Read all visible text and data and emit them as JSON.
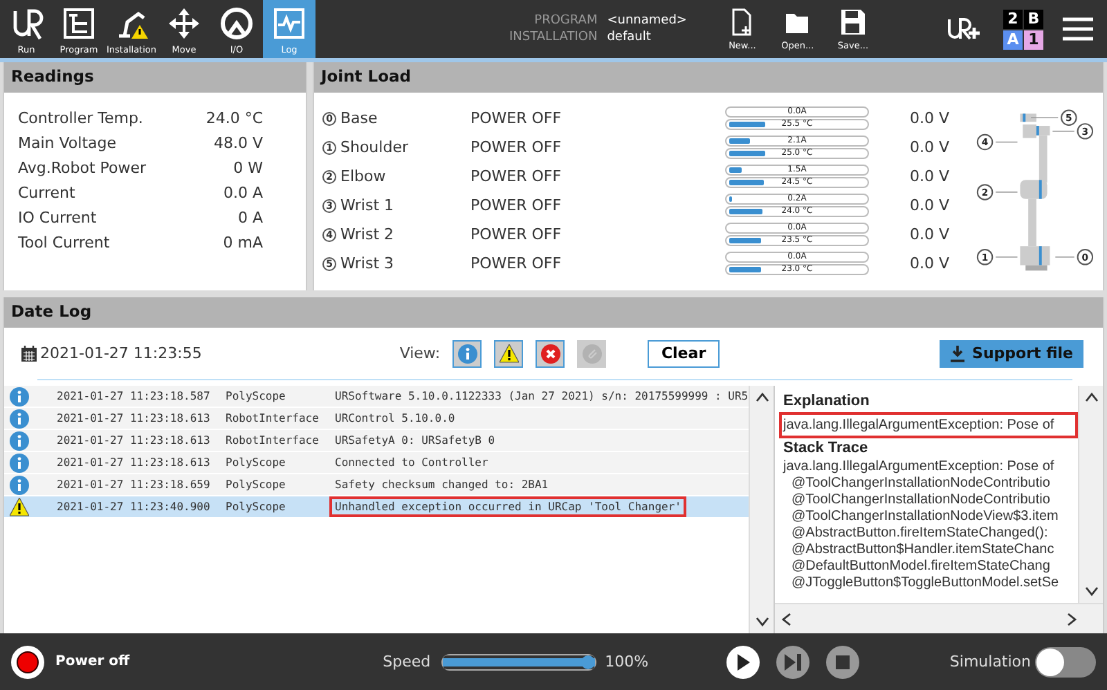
{
  "nav": [
    {
      "kind": "run",
      "label": "Run",
      "selected": false
    },
    {
      "kind": "program",
      "label": "Program",
      "selected": false
    },
    {
      "kind": "installation",
      "label": "Installation",
      "selected": false
    },
    {
      "kind": "move",
      "label": "Move",
      "selected": false
    },
    {
      "kind": "io",
      "label": "I/O",
      "selected": false
    },
    {
      "kind": "log",
      "label": "Log",
      "selected": true
    }
  ],
  "program_info": [
    {
      "label": "PROGRAM",
      "value": "<unnamed>"
    },
    {
      "label": "INSTALLATION",
      "value": "default"
    }
  ],
  "file_buttons": [
    {
      "kind": "new",
      "label": "New..."
    },
    {
      "kind": "open",
      "label": "Open..."
    },
    {
      "kind": "save",
      "label": "Save..."
    }
  ],
  "safety_status": [
    {
      "text": "2",
      "color": "#000000"
    },
    {
      "text": "B",
      "color": "#000000"
    },
    {
      "text": "A",
      "color": "#5b8ff0"
    },
    {
      "text": "1",
      "color": "#e6a8e6"
    }
  ],
  "readings": {
    "title": "Readings",
    "rows": [
      {
        "label": "Controller Temp.",
        "value": "24.0 °C"
      },
      {
        "label": "Main Voltage",
        "value": "48.0 V"
      },
      {
        "label": "Avg.Robot Power",
        "value": "0 W"
      },
      {
        "label": "Current",
        "value": "0.0 A"
      },
      {
        "label": "IO Current",
        "value": "0 A"
      },
      {
        "label": "Tool Current",
        "value": "0 mA"
      }
    ]
  },
  "joint_load": {
    "title": "Joint Load",
    "joints": [
      {
        "index": "0",
        "name": "Base",
        "status": "POWER OFF",
        "current": {
          "text": "0.0A",
          "level": 0
        },
        "temperature": {
          "text": "25.5 °C",
          "level": 0.25
        },
        "voltage": "0.0 V"
      },
      {
        "index": "1",
        "name": "Shoulder",
        "status": "POWER OFF",
        "current": {
          "text": "2.1A",
          "level": 0.15
        },
        "temperature": {
          "text": "25.0 °C",
          "level": 0.25
        },
        "voltage": "0.0 V"
      },
      {
        "index": "2",
        "name": "Elbow",
        "status": "POWER OFF",
        "current": {
          "text": "1.5A",
          "level": 0.09
        },
        "temperature": {
          "text": "24.5 °C",
          "level": 0.245
        },
        "voltage": "0.0 V"
      },
      {
        "index": "3",
        "name": "Wrist 1",
        "status": "POWER OFF",
        "current": {
          "text": "0.2A",
          "level": 0.02
        },
        "temperature": {
          "text": "24.0 °C",
          "level": 0.24
        },
        "voltage": "0.0 V"
      },
      {
        "index": "4",
        "name": "Wrist 2",
        "status": "POWER OFF",
        "current": {
          "text": "0.0A",
          "level": 0
        },
        "temperature": {
          "text": "23.5 °C",
          "level": 0.23
        },
        "voltage": "0.0 V"
      },
      {
        "index": "5",
        "name": "Wrist 3",
        "status": "POWER OFF",
        "current": {
          "text": "0.0A",
          "level": 0
        },
        "temperature": {
          "text": "23.0 °C",
          "level": 0.23
        },
        "voltage": "0.0 V"
      }
    ],
    "robot_callouts": [
      "5",
      "3",
      "4",
      "2",
      "1",
      "0"
    ]
  },
  "date_log": {
    "title": "Date Log",
    "date": "2021-01-27 11:23:55",
    "view_label": "View:",
    "filters": [
      {
        "kind": "info",
        "on": true
      },
      {
        "kind": "warning",
        "on": true
      },
      {
        "kind": "error",
        "on": true
      },
      {
        "kind": "attachment",
        "on": false
      }
    ],
    "clear_button": "Clear",
    "support_button": "Support file",
    "entries": [
      {
        "kind": "info",
        "time": "2021-01-27 11:23:18.587",
        "source": "PolyScope",
        "message": "URSoftware 5.10.0.1122333 (Jan 27 2021) s/n: 20175599999 : UR5",
        "selected": false,
        "highlighted": false
      },
      {
        "kind": "info",
        "time": "2021-01-27 11:23:18.613",
        "source": "RobotInterface",
        "message": "URControl 5.10.0.0",
        "selected": false,
        "highlighted": false
      },
      {
        "kind": "info",
        "time": "2021-01-27 11:23:18.613",
        "source": "RobotInterface",
        "message": "URSafetyA 0: URSafetyB 0",
        "selected": false,
        "highlighted": false
      },
      {
        "kind": "info",
        "time": "2021-01-27 11:23:18.613",
        "source": "PolyScope",
        "message": "Connected to Controller",
        "selected": false,
        "highlighted": false
      },
      {
        "kind": "info",
        "time": "2021-01-27 11:23:18.659",
        "source": "PolyScope",
        "message": "Safety checksum changed to: 2BA1",
        "selected": false,
        "highlighted": false
      },
      {
        "kind": "warning",
        "time": "2021-01-27 11:23:40.900",
        "source": "PolyScope",
        "message": "Unhandled exception occurred in URCap 'Tool Changer'",
        "selected": true,
        "highlighted": true
      }
    ],
    "explanation": {
      "title": "Explanation",
      "text": "java.lang.IllegalArgumentException: Pose of",
      "highlighted": true
    },
    "stack_trace": {
      "title": "Stack Trace",
      "lines": [
        "java.lang.IllegalArgumentException: Pose of",
        "@ToolChangerInstallationNodeContributio",
        "@ToolChangerInstallationNodeContributio",
        "@ToolChangerInstallationNodeView$3.item",
        "@AbstractButton.fireItemStateChanged():",
        "@AbstractButton$Handler.itemStateChanc",
        "@DefaultButtonModel.fireItemStateChang",
        "@JToggleButton$ToggleButtonModel.setSe"
      ]
    }
  },
  "footer": {
    "power_label": "Power off",
    "speed_label": "Speed",
    "speed": {
      "level": 1.0
    },
    "speed_value": "100%",
    "simulation_label": "Simulation",
    "simulation_on": false
  }
}
